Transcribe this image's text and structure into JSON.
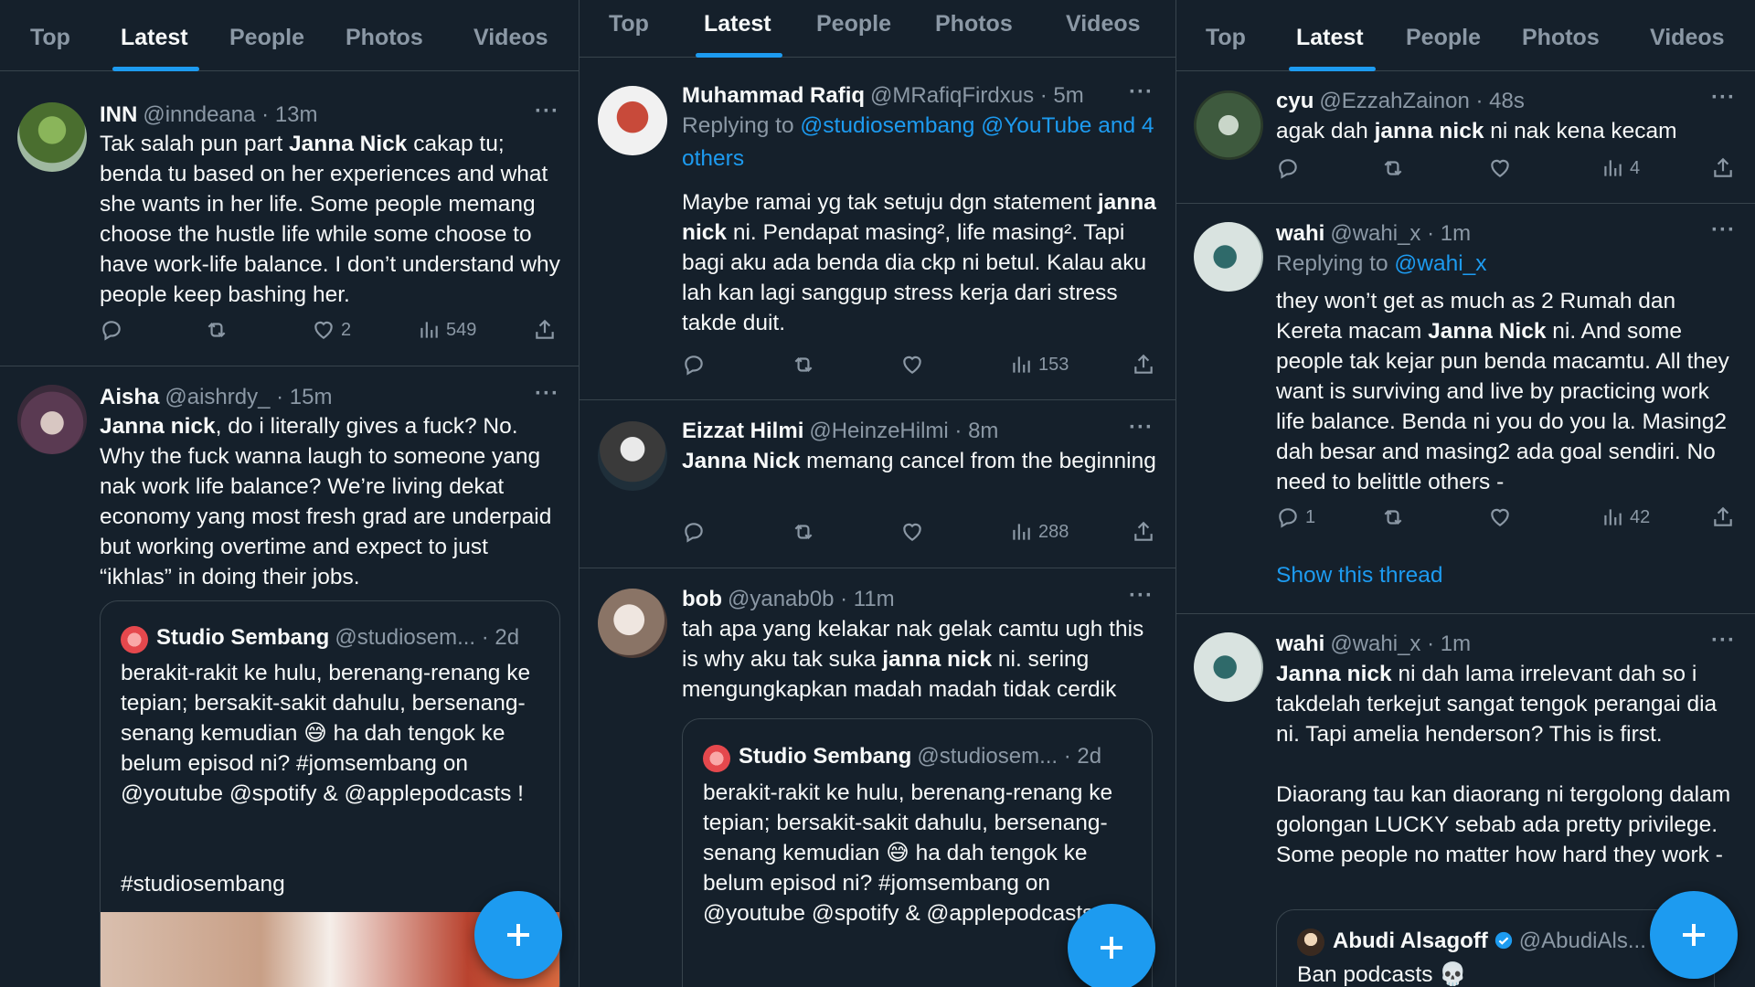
{
  "tabs": [
    "Top",
    "Latest",
    "People",
    "Photos",
    "Videos"
  ],
  "columns": [
    {
      "tweets": [
        {
          "name": "INN",
          "handle": "@inndeana",
          "time": "· 13m",
          "avatar_color": "#5b7b3a",
          "body_html": "Tak salah pun part <b>Janna Nick</b> cakap tu; benda tu based on her experiences and what she wants in her life. Some people memang choose the hustle life while some choose to have work-life balance. I don’t understand why people keep bashing her.",
          "replies": "",
          "retweets": "",
          "likes": "2",
          "views": "549"
        },
        {
          "name": "Aisha",
          "handle": "@aishrdy_",
          "time": "· 15m",
          "avatar_color": "#7a5a6a",
          "body_html": "<b>Janna nick</b>, do i literally gives a fuck? No. Why the fuck wanna laugh to someone yang nak work life balance? We’re living dekat economy yang most fresh grad are underpaid but working overtime and expect to just “ikhlas” in doing their jobs.",
          "quote": {
            "name": "Studio Sembang",
            "handle": "@studiosem...",
            "time": "· 2d",
            "body": "berakit-rakit ke hulu, berenang-renang ke tepian; bersakit-sakit dahulu, bersenang-senang kemudian 😅 ha dah tengok ke belum episod ni? #jomsembang on @youtube @spotify & @applepodcasts !",
            "hashtag": "#studiosembang"
          }
        }
      ]
    },
    {
      "tweets": [
        {
          "name": "Muhammad Rafiq",
          "handle": "@MRafiqFirdxus",
          "time": "· 5m",
          "avatar_color": "#b33a3a",
          "reply_prefix": "Replying to",
          "reply_targets": "@studiosembang @YouTube and 4 others",
          "body_html": "Maybe ramai yg tak setuju dgn statement <b>janna nick</b> ni. Pendapat masing², life masing². Tapi bagi aku ada benda dia ckp ni betul. Kalau aku lah kan lagi sanggup stress kerja dari stress takde duit.",
          "replies": "",
          "retweets": "",
          "likes": "",
          "views": "153"
        },
        {
          "name": "Eizzat Hilmi",
          "handle": "@HeinzeHilmi",
          "time": "· 8m",
          "avatar_color": "#3a3a3a",
          "body_html": "<b>Janna Nick</b> memang cancel from the beginning",
          "replies": "",
          "retweets": "",
          "likes": "",
          "views": "288"
        },
        {
          "name": "bob",
          "handle": "@yanab0b",
          "time": "· 11m",
          "avatar_color": "#8a7a70",
          "body_html": "tah apa yang kelakar nak gelak camtu ugh this is why aku tak suka <b>janna nick</b> ni. sering mengungkapkan madah madah tidak cerdik",
          "quote": {
            "name": "Studio Sembang",
            "handle": "@studiosem...",
            "time": "· 2d",
            "body": "berakit-rakit ke hulu, berenang-renang ke tepian; bersakit-sakit dahulu, bersenang-senang kemudian 😅 ha dah tengok ke belum episod ni? #jomsembang on @youtube @spotify & @applepodcasts !"
          }
        }
      ]
    },
    {
      "tweets": [
        {
          "name": "cyu",
          "handle": "@EzzahZainon",
          "time": "· 48s",
          "avatar_color": "#4a6a4a",
          "body_html": "agak dah <b>janna nick</b> ni nak kena kecam",
          "replies": "",
          "retweets": "",
          "likes": "",
          "views": "4"
        },
        {
          "name": "wahi",
          "handle": "@wahi_x",
          "time": "· 1m",
          "avatar_color": "#6a8a8a",
          "reply_prefix": "Replying to",
          "reply_targets": "@wahi_x",
          "body_html": "they won’t get as much as 2 Rumah dan Kereta macam <b>Janna Nick</b> ni. And some people tak kejar pun benda macamtu. All they want is surviving and live by practicing work life balance. Benda ni you do you la. Masing2 dah besar and masing2 ada goal sendiri. No need to belittle others -",
          "replies": "1",
          "retweets": "",
          "likes": "",
          "views": "42",
          "show_thread": "Show this thread"
        },
        {
          "name": "wahi",
          "handle": "@wahi_x",
          "time": "· 1m",
          "avatar_color": "#6a8a8a",
          "body_html": "<b>Janna nick</b> ni dah lama irrelevant dah so i takdelah terkejut sangat tengok perangai dia ni. Tapi amelia henderson? This is first.<br><br>Diaorang tau kan diaorang ni tergolong dalam golongan LUCKY sebab ada pretty privilege. Some people no matter how hard they work -",
          "quote": {
            "name": "Abudi Alsagoff",
            "handle": "@AbudiAls...",
            "body": "Ban podcasts 💀"
          }
        }
      ]
    }
  ],
  "colors": {
    "background": "#15202b",
    "border": "#38444d",
    "accent": "#1d9bf0",
    "muted": "#8b98a5",
    "text": "#f7f9f9"
  },
  "icons": [
    "reply-icon",
    "retweet-icon",
    "like-icon",
    "views-icon",
    "share-icon",
    "more-icon",
    "compose-plus-icon",
    "verified-icon"
  ]
}
